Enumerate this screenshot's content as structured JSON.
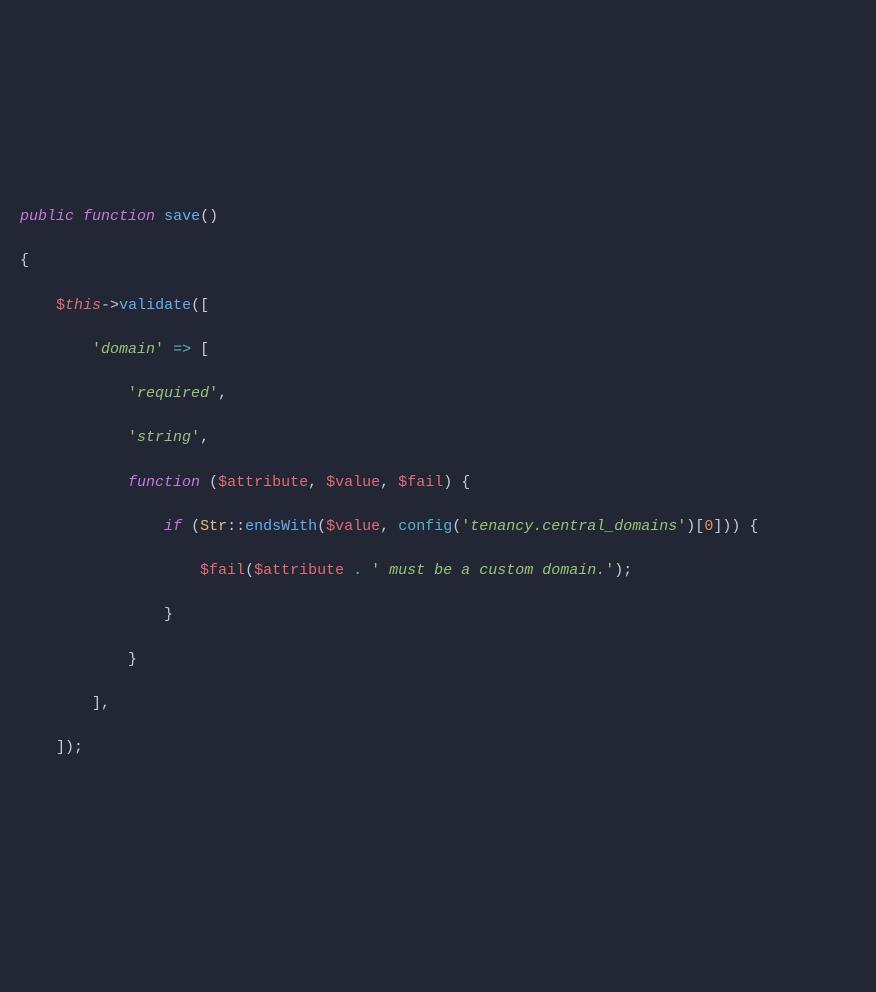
{
  "code": {
    "l1": {
      "public": "public",
      "function": "function",
      "name": "save",
      "parens": "()"
    },
    "l2": {
      "brace": "{"
    },
    "l3": {
      "dollar": "$",
      "this": "this",
      "arrow": "->",
      "validate": "validate",
      "open": "(["
    },
    "l4": {
      "q1": "'",
      "domain": "domain",
      "q2": "'",
      "fat": "=>",
      "br": "["
    },
    "l5": {
      "q1": "'",
      "required": "required",
      "q2": "'",
      "comma": ","
    },
    "l6": {
      "q1": "'",
      "string": "string",
      "q2": "'",
      "comma": ","
    },
    "l7": {
      "function": "function",
      "op": "(",
      "d1": "$",
      "attr": "attribute",
      "c1": ", ",
      "d2": "$",
      "val": "value",
      "c2": ", ",
      "d3": "$",
      "fail": "fail",
      "cp": ")",
      "ob": "{"
    },
    "l8": {
      "if": "if",
      "op": "(",
      "cls": "Str",
      "dc": "::",
      "ew": "endsWith",
      "op2": "(",
      "d1": "$",
      "val": "value",
      "c1": ", ",
      "cfg": "config",
      "op3": "(",
      "q1": "'",
      "cfgstr": "tenancy.central_domains",
      "q2": "'",
      "cp3": ")[",
      "num": "0",
      "cp4": "]))",
      "ob": "{"
    },
    "l9": {
      "d1": "$",
      "fail": "fail",
      "op": "(",
      "d2": "$",
      "attr": "attribute",
      "cat": ".",
      "q1": "'",
      "msg": " must be a custom domain.",
      "q2": "'",
      "cp": ");"
    },
    "l10": {
      "cb": "}"
    },
    "l11": {
      "cb": "}"
    },
    "l12": {
      "cb": "],"
    },
    "l13": {
      "cb": "]);"
    }
  }
}
